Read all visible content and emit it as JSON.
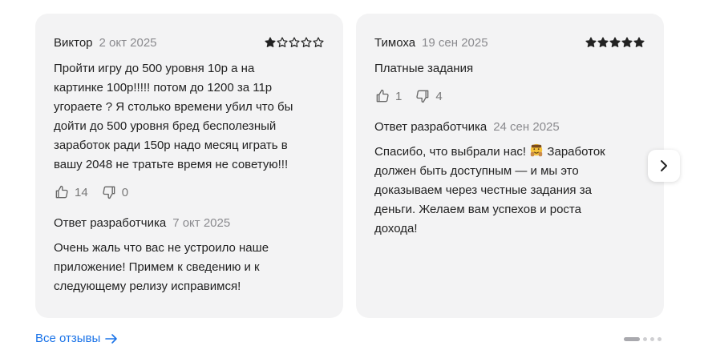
{
  "reviews": [
    {
      "author": "Виктор",
      "date": "2 окт 2025",
      "rating": 1,
      "lines": [
        "Пройти игру до 500 уровня 10р а на",
        "картинке 100р!!!!! потом до 1200 за 11р",
        "угораете ? Я столько времени убил что бы",
        "дойти до 500 уровня бред бесполезный",
        "заработок ради 150р надо месяц играть в",
        "вашу 2048 не тратьте время не советую!!!"
      ],
      "likes": "14",
      "dislikes": "0",
      "reply_title": "Ответ разработчика",
      "reply_date": "7 окт 2025",
      "reply_lines": [
        "Очень жаль что вас не устроило наше",
        "приложение! Примем к сведению и к",
        "следующему релизу исправимся!"
      ]
    },
    {
      "author": "Тимоха",
      "date": "19 сен 2025",
      "rating": 5,
      "lines": [
        "Платные задания"
      ],
      "likes": "1",
      "dislikes": "4",
      "reply_title": "Ответ разработчика",
      "reply_date": "24 сен 2025",
      "reply_lines_first_pre": "Спасибо, что выбрали нас! ",
      "reply_lines_first_post": " Заработок",
      "reply_lines": [
        "должен быть доступным — и мы это",
        "доказываем через честные задания за",
        "деньги. Желаем вам успехов и роста",
        "дохода!"
      ]
    }
  ],
  "footer": {
    "all_reviews": "Все отзывы"
  },
  "pagination": {
    "total": 4,
    "active": 0
  },
  "colors": {
    "card_bg": "#f3f3f4",
    "link": "#1a73e8",
    "star": "#222222"
  },
  "icons": [
    "star-icon",
    "thumb-up-icon",
    "thumb-down-icon",
    "chevron-right-icon",
    "arrow-right-icon",
    "hugging-face-emoji"
  ]
}
